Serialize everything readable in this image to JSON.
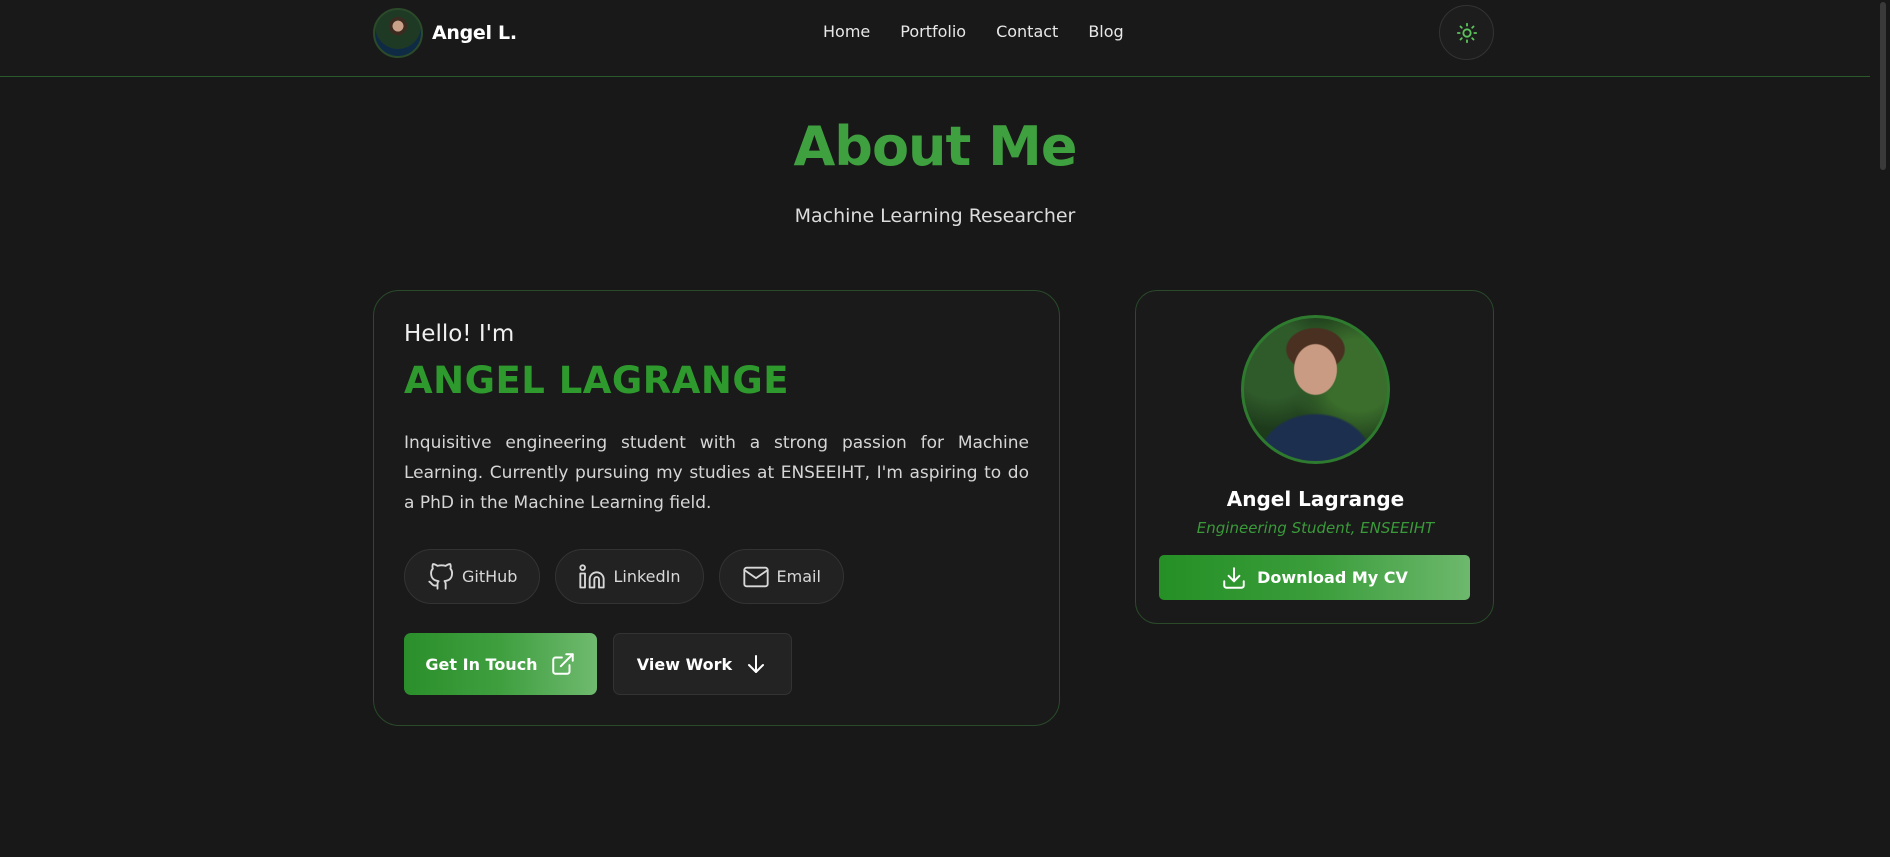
{
  "header": {
    "brand_name": "Angel L.",
    "nav": [
      "Home",
      "Portfolio",
      "Contact",
      "Blog"
    ],
    "theme_toggle_icon": "sun-icon"
  },
  "hero": {
    "title": "About Me",
    "subtitle": "Machine Learning Researcher"
  },
  "intro": {
    "greeting": "Hello! I'm",
    "name": "ANGEL LAGRANGE",
    "bio": "Inquisitive engineering student with a strong passion for Machine Learning. Currently pursuing my studies at ENSEEIHT, I'm aspiring to do a PhD in the Machine Learning field.",
    "socials": [
      {
        "label": "GitHub",
        "icon": "github-icon"
      },
      {
        "label": "LinkedIn",
        "icon": "linkedin-icon"
      },
      {
        "label": "Email",
        "icon": "mail-icon"
      }
    ],
    "primary_action": "Get In Touch",
    "secondary_action": "View Work"
  },
  "profile": {
    "name": "Angel Lagrange",
    "role": "Engineering Student, ENSEEIHT",
    "cv_button": "Download My CV"
  },
  "colors": {
    "accent": "#3fa03f",
    "background": "#181818"
  }
}
